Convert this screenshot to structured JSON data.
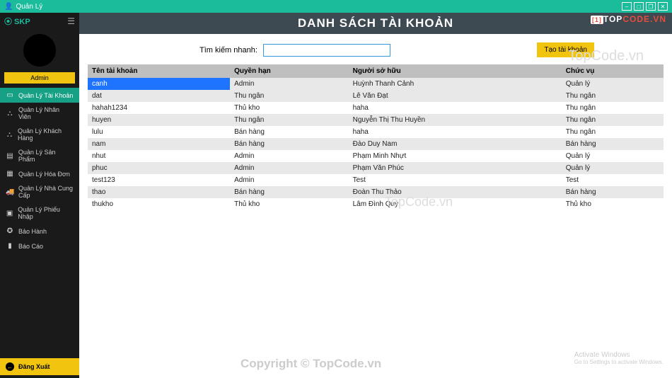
{
  "titlebar": {
    "title": "Quản Lý"
  },
  "sidebar": {
    "logo": "⦿ SKP",
    "user_badge": "Admin",
    "items": [
      {
        "icon": "▭",
        "label": "Quản Lý Tài Khoản",
        "active": true
      },
      {
        "icon": "⛬",
        "label": "Quản Lý Nhân Viên"
      },
      {
        "icon": "⛬",
        "label": "Quản Lý Khách Hàng"
      },
      {
        "icon": "▤",
        "label": "Quản Lý Sản Phẩm"
      },
      {
        "icon": "▦",
        "label": "Quản Lý Hóa Đơn"
      },
      {
        "icon": "🚚",
        "label": "Quản Lý Nhà Cung Cấp"
      },
      {
        "icon": "▣",
        "label": "Quản Lý Phiếu Nhập"
      },
      {
        "icon": "✪",
        "label": "Bảo Hành"
      },
      {
        "icon": "▮",
        "label": "Báo Cáo"
      }
    ],
    "logout": "Đăng Xuất"
  },
  "header": {
    "title": "DANH SÁCH TÀI KHOẢN"
  },
  "brand": {
    "pre": "[1]",
    "mid": "TOP",
    "suf": "CODE.VN"
  },
  "toolbar": {
    "search_label": "Tìm kiếm nhanh:",
    "search_value": "",
    "create_label": "Tạo tài khoản"
  },
  "table": {
    "columns": [
      "Tên tài khoản",
      "Quyền hạn",
      "Người sở hữu",
      "Chức vụ"
    ],
    "rows": [
      {
        "c": [
          "canh",
          "Admin",
          "Huỳnh Thanh Cảnh",
          "Quản lý"
        ],
        "selected": true
      },
      {
        "c": [
          "dat",
          "Thu ngân",
          "Lê Văn Đạt",
          "Thu ngân"
        ]
      },
      {
        "c": [
          "hahah1234",
          "Thủ kho",
          "haha",
          "Thu ngân"
        ]
      },
      {
        "c": [
          "huyen",
          "Thu ngân",
          "Nguyễn Thị Thu Huyền",
          "Thu ngân"
        ]
      },
      {
        "c": [
          "lulu",
          "Bán hàng",
          "haha",
          "Thu ngân"
        ]
      },
      {
        "c": [
          "nam",
          "Bán hàng",
          "Đào Duy Nam",
          "Bán hàng"
        ]
      },
      {
        "c": [
          "nhut",
          "Admin",
          "Phạm Minh Nhựt",
          "Quản lý"
        ]
      },
      {
        "c": [
          "phuc",
          "Admin",
          "Phạm Văn Phúc",
          "Quản lý"
        ]
      },
      {
        "c": [
          "test123",
          "Admin",
          "Test",
          "Test"
        ]
      },
      {
        "c": [
          "thao",
          "Bán hàng",
          "Đoàn Thu Thảo",
          "Bán hàng"
        ]
      },
      {
        "c": [
          "thukho",
          "Thủ kho",
          "Lâm Đình Quý",
          "Thủ kho"
        ]
      }
    ]
  },
  "watermarks": {
    "wm1": "TopCode.vn",
    "wm2": "Copyright © TopCode.vn",
    "wm3": "TopCode.vn",
    "activate1": "Activate Windows",
    "activate2": "Go to Settings to activate Windows."
  }
}
